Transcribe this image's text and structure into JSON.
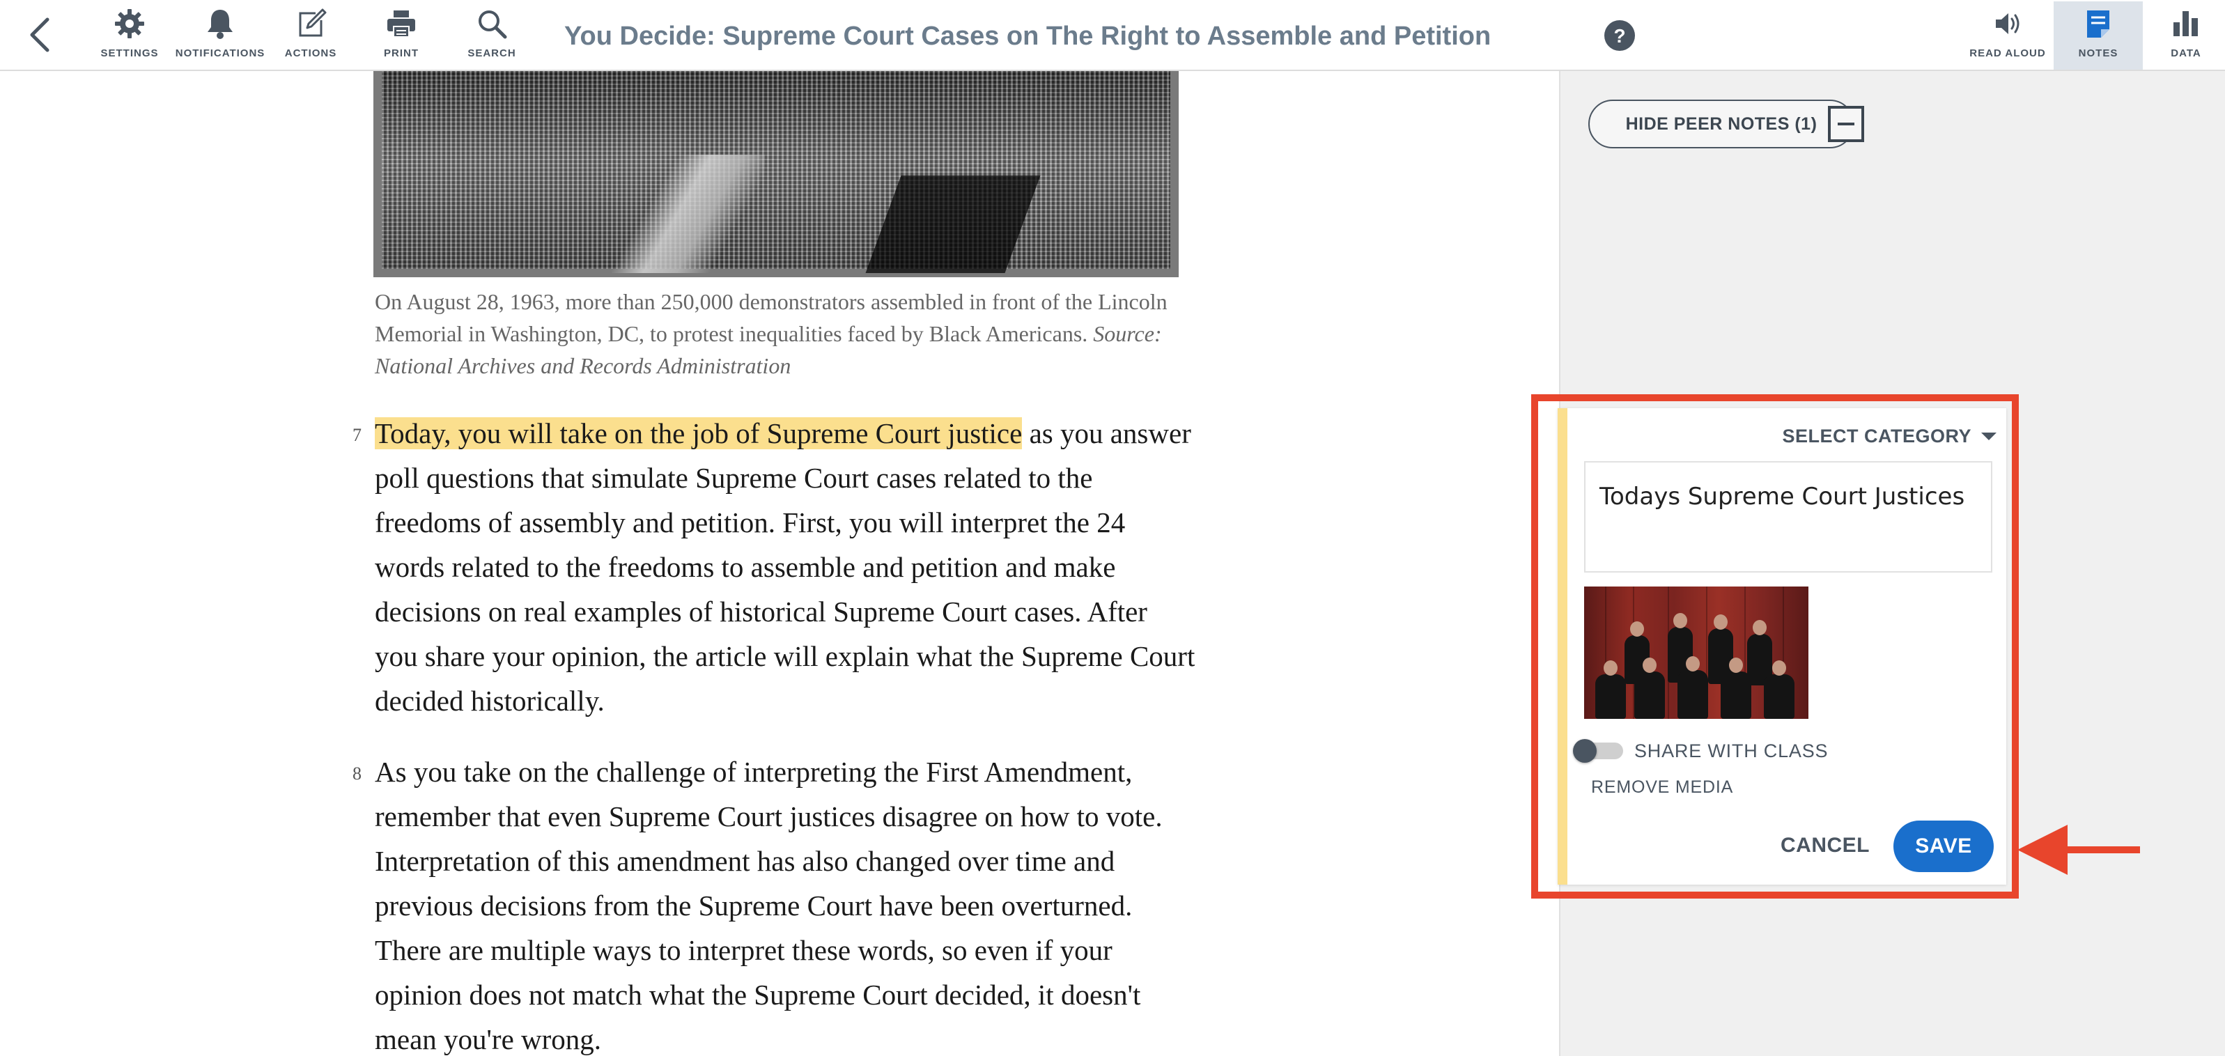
{
  "toolbar": {
    "title": "You Decide: Supreme Court Cases on The Right to Assemble and Petition",
    "tools": {
      "settings": "SETTINGS",
      "notifications": "NOTIFICATIONS",
      "actions": "ACTIONS",
      "print": "PRINT",
      "search": "SEARCH",
      "read_aloud": "READ ALOUD",
      "notes": "NOTES",
      "data": "DATA"
    },
    "icons": [
      "back-arrow-icon",
      "gear-icon",
      "bell-icon",
      "edit-icon",
      "printer-icon",
      "search-icon",
      "help-icon",
      "speaker-icon",
      "notes-icon",
      "bar-chart-icon"
    ],
    "active_tool": "notes"
  },
  "article": {
    "caption_main": "On August 28, 1963, more than 250,000 demonstrators assembled in front of the Lincoln Memorial in Washington, DC, to protest inequalities faced by Black Americans.",
    "caption_source": "Source: National Archives and Records Administration",
    "paragraphs": [
      {
        "number": "7",
        "highlighted": "Today, you will take on the job of Supreme Court justice",
        "text": " as you answer poll questions that simulate Supreme Court cases related to the freedoms of assembly and petition. First, you will interpret the 24 words related to the freedoms to assemble and petition and make decisions on real examples of historical Supreme Court cases. After you share your opinion, the article will explain what the Supreme Court decided historically."
      },
      {
        "number": "8",
        "text": "As you take on the challenge of interpreting the First Amendment, remember that even Supreme Court justices disagree on how to vote. Interpretation of this amendment has also changed over time and previous decisions from the Supreme Court have been overturned. There are multiple ways to interpret these words, so even if your opinion does not match what the Supreme Court decided, it doesn't mean you're wrong."
      }
    ]
  },
  "notes_panel": {
    "peer_notes_button": "HIDE PEER NOTES (1)",
    "note": {
      "category_label": "SELECT CATEGORY",
      "text": "Todays Supreme Court Justices",
      "share_label": "SHARE WITH CLASS",
      "share_enabled": false,
      "remove_media": "REMOVE MEDIA",
      "cancel": "CANCEL",
      "save": "SAVE"
    }
  },
  "colors": {
    "highlight": "#fbdf8e",
    "annotation_red": "#e8452c",
    "save_blue": "#1a6fcc",
    "toolbar_text": "#4a5561",
    "title_text": "#6b7c8c"
  }
}
